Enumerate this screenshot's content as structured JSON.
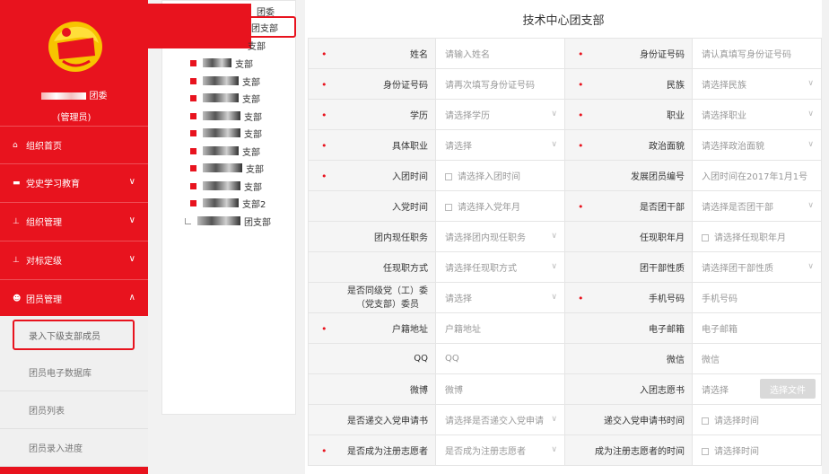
{
  "sidebar": {
    "org_suffix": "团委",
    "role": "(管理员)",
    "nav": [
      {
        "label": "组织首页",
        "icon": "home-icon",
        "expandable": false
      },
      {
        "label": "党史学习教育",
        "icon": "folder-icon",
        "expandable": true
      },
      {
        "label": "组织管理",
        "icon": "org-chart-icon",
        "expandable": true
      },
      {
        "label": "对标定级",
        "icon": "hierarchy-icon",
        "expandable": true
      },
      {
        "label": "团员管理",
        "icon": "members-icon",
        "expandable": true,
        "expanded": true
      }
    ],
    "sub_items": [
      "录入下级支部成员",
      "团员电子数据库",
      "团员列表",
      "团员录入进度"
    ],
    "active_sub": "录入下级支部成员",
    "chevron_down": "∨",
    "chevron_up": "∧"
  },
  "tree": {
    "root": "团委",
    "selected": "团支部",
    "nodes": [
      "支部",
      "支部",
      "支部",
      "支部",
      "支部",
      "支部",
      "支部",
      "支部",
      "支部",
      "支部2",
      "团支部"
    ]
  },
  "form": {
    "title": "技术中心团支部",
    "rows": [
      [
        {
          "label": "姓名",
          "req": true,
          "value": "请输入姓名"
        },
        {
          "label": "身份证号码",
          "req": true,
          "value": "请认真填写身份证号码"
        }
      ],
      [
        {
          "label": "身份证号码",
          "req": true,
          "value": "请再次填写身份证号码"
        },
        {
          "label": "民族",
          "req": true,
          "value": "请选择民族",
          "select": true
        }
      ],
      [
        {
          "label": "学历",
          "req": true,
          "value": "请选择学历",
          "select": true
        },
        {
          "label": "职业",
          "req": true,
          "value": "请选择职业",
          "select": true
        }
      ],
      [
        {
          "label": "具体职业",
          "req": true,
          "value": "请选择",
          "select": true
        },
        {
          "label": "政治面貌",
          "req": true,
          "value": "请选择政治面貌",
          "select": true
        }
      ],
      [
        {
          "label": "入团时间",
          "req": true,
          "value": "请选择入团时间",
          "date": true
        },
        {
          "label": "发展团员编号",
          "req": false,
          "value": "入团时间在2017年1月1号"
        }
      ],
      [
        {
          "label": "入党时间",
          "req": false,
          "value": "请选择入党年月",
          "date": true
        },
        {
          "label": "是否团干部",
          "req": true,
          "value": "请选择是否团干部",
          "select": true
        }
      ],
      [
        {
          "label": "团内现任职务",
          "req": false,
          "value": "请选择团内现任职务",
          "select": true
        },
        {
          "label": "任现职年月",
          "req": false,
          "value": "请选择任现职年月",
          "date": true
        }
      ],
      [
        {
          "label": "任现职方式",
          "req": false,
          "value": "请选择任现职方式",
          "select": true
        },
        {
          "label": "团干部性质",
          "req": false,
          "value": "请选择团干部性质",
          "select": true
        }
      ],
      [
        {
          "label": "是否同级党（工）委（党支部）委员",
          "req": false,
          "value": "请选择",
          "select": true,
          "two": [
            "是否同级党（工）委",
            "（党支部）委员"
          ]
        },
        {
          "label": "手机号码",
          "req": true,
          "value": "手机号码"
        }
      ],
      [
        {
          "label": "户籍地址",
          "req": true,
          "value": "户籍地址"
        },
        {
          "label": "电子邮箱",
          "req": false,
          "value": "电子邮箱"
        }
      ],
      [
        {
          "label": "QQ",
          "req": false,
          "value": "QQ"
        },
        {
          "label": "微信",
          "req": false,
          "value": "微信"
        }
      ],
      [
        {
          "label": "微博",
          "req": false,
          "value": "微博"
        },
        {
          "label": "入团志愿书",
          "req": false,
          "value": "请选择",
          "upload": true
        }
      ],
      [
        {
          "label": "是否递交入党申请书",
          "req": false,
          "value": "请选择是否递交入党申请",
          "select": true
        },
        {
          "label": "递交入党申请书时间",
          "req": false,
          "value": "请选择时间",
          "date": true
        }
      ],
      [
        {
          "label": "是否成为注册志愿者",
          "req": true,
          "value": "是否成为注册志愿者",
          "select": true
        },
        {
          "label": "成为注册志愿者的时间",
          "req": false,
          "value": "请选择时间",
          "date": true
        }
      ]
    ],
    "upload_label": "选择文件"
  },
  "colors": {
    "brand_red": "#e8131e",
    "label_bg": "#f5f5f5"
  }
}
